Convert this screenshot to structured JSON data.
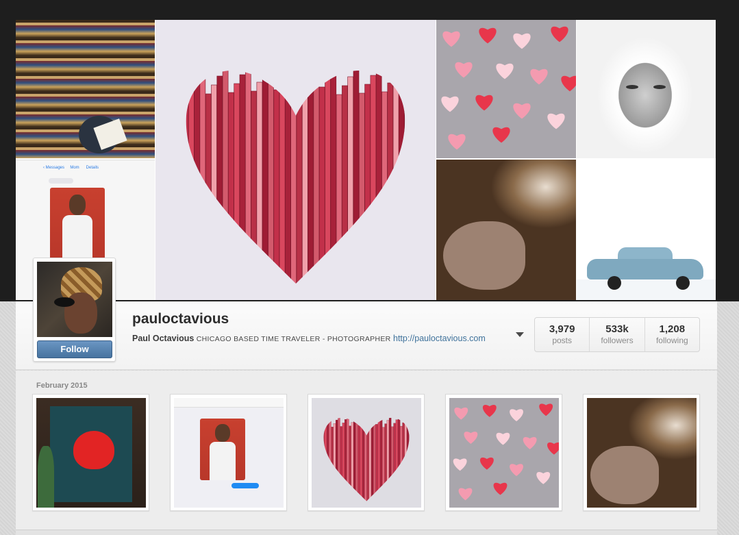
{
  "profile": {
    "username": "pauloctavious",
    "full_name": "Paul Octavious",
    "tagline": "CHICAGO BASED TIME TRAVELER - PHOTOGRAPHER",
    "website": "http://pauloctavious.com",
    "follow_label": "Follow"
  },
  "stats": [
    {
      "value": "3,979",
      "label": "posts"
    },
    {
      "value": "533k",
      "label": "followers"
    },
    {
      "value": "1,208",
      "label": "following"
    }
  ],
  "feed": {
    "month": "February 2015"
  },
  "cover_photos": [
    "books-library-photo",
    "message-screenshot-photo",
    "book-spine-heart-photo",
    "paper-hearts-photo",
    "portrait-photo",
    "hand-deer-photo",
    "vintage-car-photo"
  ],
  "thumbnails": [
    "woman-heart-costume",
    "message-screenshot",
    "book-spine-heart",
    "paper-hearts",
    "hand-deer"
  ],
  "colors": {
    "accent": "#3f729b",
    "follow_button": "#517fa4",
    "heart_red": "#c2304a"
  }
}
